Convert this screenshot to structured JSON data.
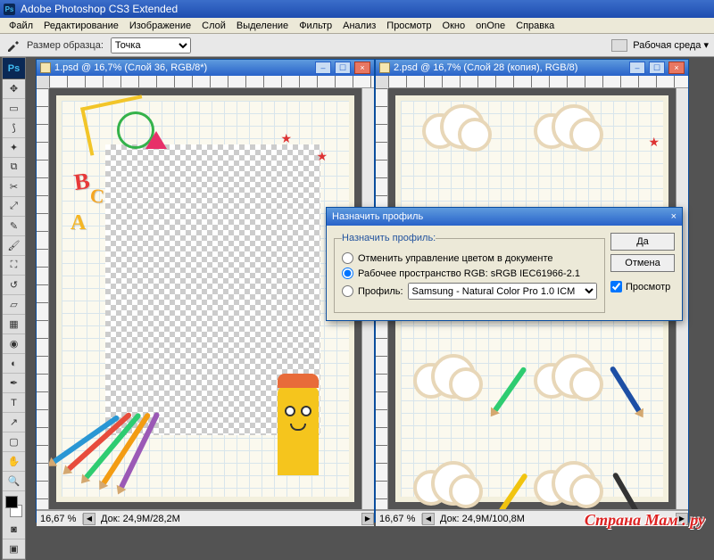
{
  "app": {
    "title": "Adobe Photoshop CS3 Extended"
  },
  "menu": [
    "Файл",
    "Редактирование",
    "Изображение",
    "Слой",
    "Выделение",
    "Фильтр",
    "Анализ",
    "Просмотр",
    "Окно",
    "onOne",
    "Справка"
  ],
  "options": {
    "sample_label": "Размер образца:",
    "sample_value": "Точка",
    "workspace_label": "Рабочая среда ▾"
  },
  "tools": {
    "ps": "Ps",
    "list": [
      "move",
      "marquee",
      "lasso",
      "wand",
      "crop",
      "slice",
      "eyedropper",
      "healing",
      "brush",
      "stamp",
      "history",
      "eraser",
      "gradient",
      "blur",
      "dodge",
      "pen",
      "type",
      "path",
      "rectangle",
      "notes",
      "hand",
      "zoom"
    ]
  },
  "doc1": {
    "title": "1.psd @ 16,7% (Слой 36, RGB/8*)",
    "zoom": "16,67 %",
    "info": "Док: 24,9M/28,2M"
  },
  "doc2": {
    "title": "2.psd @ 16,7% (Слой 28 (копия), RGB/8)",
    "zoom": "16,67 %",
    "info": "Док: 24,9M/100,8M"
  },
  "dialog": {
    "title": "Назначить профиль",
    "legend": "Назначить профиль:",
    "opt1": "Отменить управление цветом в документе",
    "opt2": "Рабочее пространство RGB:  sRGB IEC61966-2.1",
    "opt3": "Профиль:",
    "profile_value": "Samsung - Natural Color Pro 1.0 ICM",
    "ok": "Да",
    "cancel": "Отмена",
    "preview": "Просмотр"
  },
  "watermark": "Страна Мам . ру"
}
